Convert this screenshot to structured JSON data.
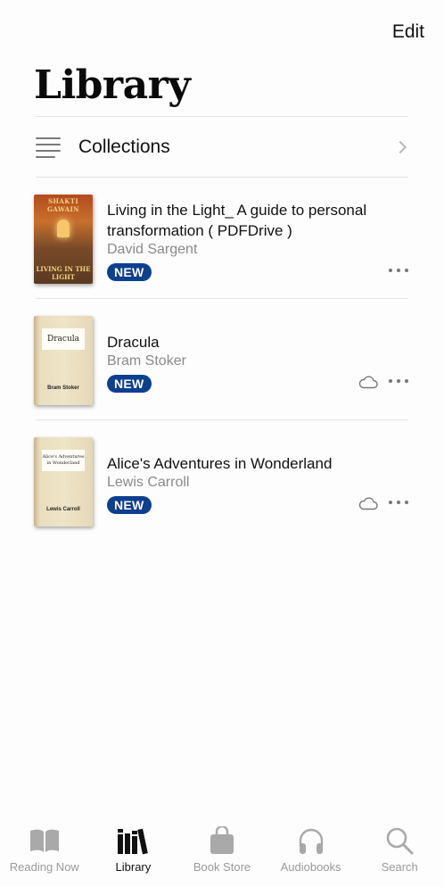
{
  "header": {
    "edit_label": "Edit",
    "title": "Library"
  },
  "collections": {
    "label": "Collections",
    "icon": "list-icon"
  },
  "books": [
    {
      "title": "Living in the Light_ A guide to personal transformation ( PDFDrive )",
      "author": "David Sargent",
      "badge": "NEW",
      "cloud": false,
      "cover_title": "SHAKTI GAWAIN",
      "cover_subtitle": "LIVING IN THE LIGHT"
    },
    {
      "title": "Dracula",
      "author": "Bram Stoker",
      "badge": "NEW",
      "cloud": true,
      "cover_title": "Dracula",
      "cover_author": "Bram Stoker"
    },
    {
      "title": "Alice's Adventures in Wonderland",
      "author": "Lewis Carroll",
      "badge": "NEW",
      "cloud": true,
      "cover_title": "Alice's Adventures in Wonderland",
      "cover_author": "Lewis Carroll"
    }
  ],
  "tabs": [
    {
      "label": "Reading Now",
      "icon": "open-book-icon",
      "active": false
    },
    {
      "label": "Library",
      "icon": "books-icon",
      "active": true
    },
    {
      "label": "Book Store",
      "icon": "shopping-bag-icon",
      "active": false
    },
    {
      "label": "Audiobooks",
      "icon": "headphones-icon",
      "active": false
    },
    {
      "label": "Search",
      "icon": "search-icon",
      "active": false
    }
  ],
  "colors": {
    "badge": "#0d3f8f",
    "tab_inactive": "#9a9a9a",
    "tab_active": "#111111"
  }
}
